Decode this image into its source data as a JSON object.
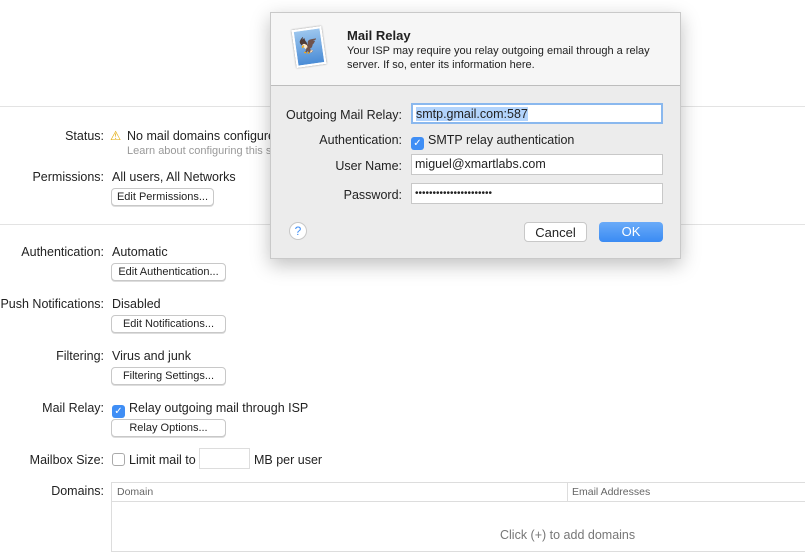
{
  "settings": {
    "status_label": "Status:",
    "status_text": "No mail domains configure",
    "status_link": "Learn about configuring this se",
    "permissions_label": "Permissions:",
    "permissions_value": "All users, All Networks",
    "edit_permissions": "Edit Permissions...",
    "authentication_label": "Authentication:",
    "authentication_value": "Automatic",
    "edit_authentication": "Edit Authentication...",
    "push_label": "Push Notifications:",
    "push_value": "Disabled",
    "edit_notifications": "Edit Notifications...",
    "filtering_label": "Filtering:",
    "filtering_value": "Virus and junk",
    "filtering_settings": "Filtering Settings...",
    "relay_label": "Mail Relay:",
    "relay_checkbox": "Relay outgoing mail through ISP",
    "relay_checked": true,
    "relay_options": "Relay Options...",
    "mailbox_label": "Mailbox Size:",
    "mailbox_checkbox": "Limit mail to",
    "mailbox_checked": false,
    "mailbox_value": "",
    "mailbox_unit": "MB per user",
    "domains_label": "Domains:",
    "domains_columns": [
      "Domain",
      "Email Addresses"
    ],
    "domains_empty": "Click (+) to add domains"
  },
  "dialog": {
    "title": "Mail Relay",
    "description": "Your ISP may require you relay outgoing email through a relay server. If so, enter its information here.",
    "relay_label": "Outgoing Mail Relay:",
    "relay_value": "smtp.gmail.com:587",
    "auth_label": "Authentication:",
    "auth_checkbox": "SMTP relay authentication",
    "auth_checked": true,
    "user_label": "User Name:",
    "user_value": "miguel@xmartlabs.com",
    "password_label": "Password:",
    "password_value": "••••••••••••••••••••••",
    "help": "?",
    "cancel": "Cancel",
    "ok": "OK"
  },
  "colors": {
    "accent": "#3f8ef5",
    "warning": "#f5c400"
  }
}
